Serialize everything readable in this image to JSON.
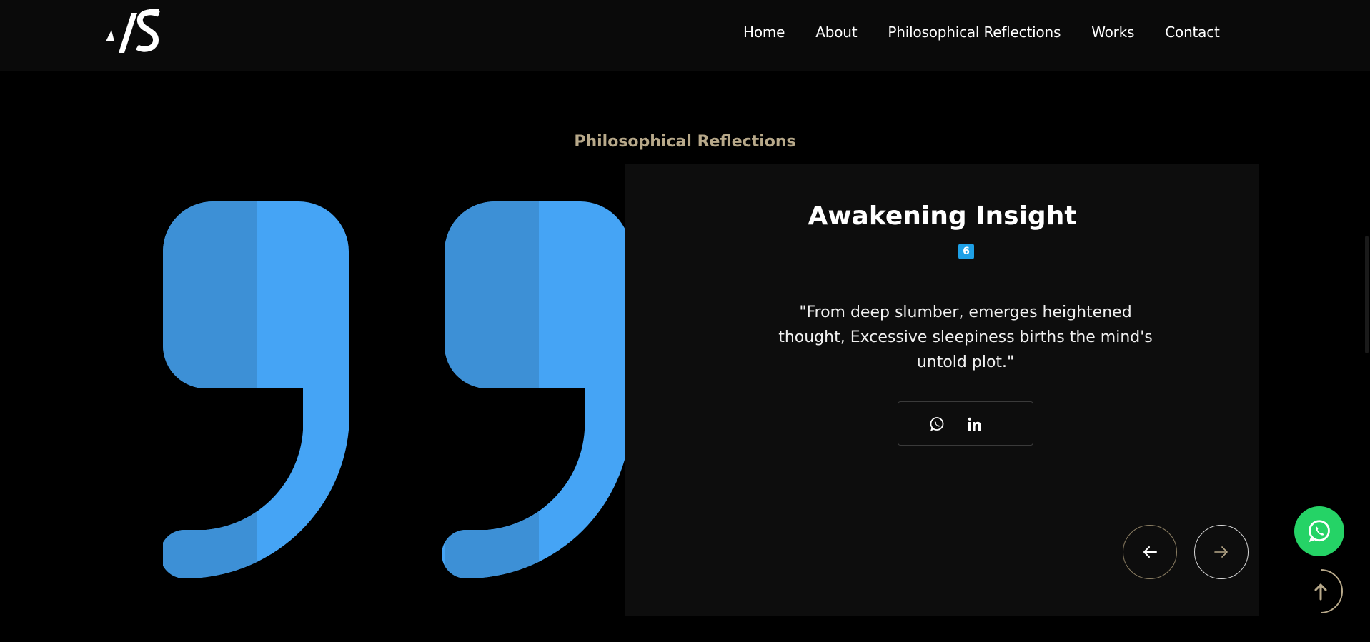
{
  "nav": {
    "logo_alt": "AS",
    "links": [
      "Home",
      "About",
      "Philosophical Reflections",
      "Works",
      "Contact"
    ]
  },
  "section": {
    "heading": "Philosophical Reflections",
    "heading_color": "#b8a98a"
  },
  "card": {
    "title": "Awakening Insight",
    "badge": "6",
    "quote": "\"From deep slumber, emerges heightened thought, Excessive sleepiness births the mind's untold plot.\"",
    "share": [
      "whatsapp-icon",
      "linkedin-icon"
    ]
  },
  "carousel": {
    "prev": "arrow-left-icon",
    "next": "arrow-right-icon"
  },
  "floating": {
    "whatsapp": "whatsapp-icon",
    "whatsapp_color": "#25d366",
    "scroll_top": "arrow-up-icon"
  },
  "colors": {
    "quote_mark_light": "#45a4f5",
    "quote_mark_dark": "#3d90d6",
    "card_bg": "#0d0d0d"
  }
}
